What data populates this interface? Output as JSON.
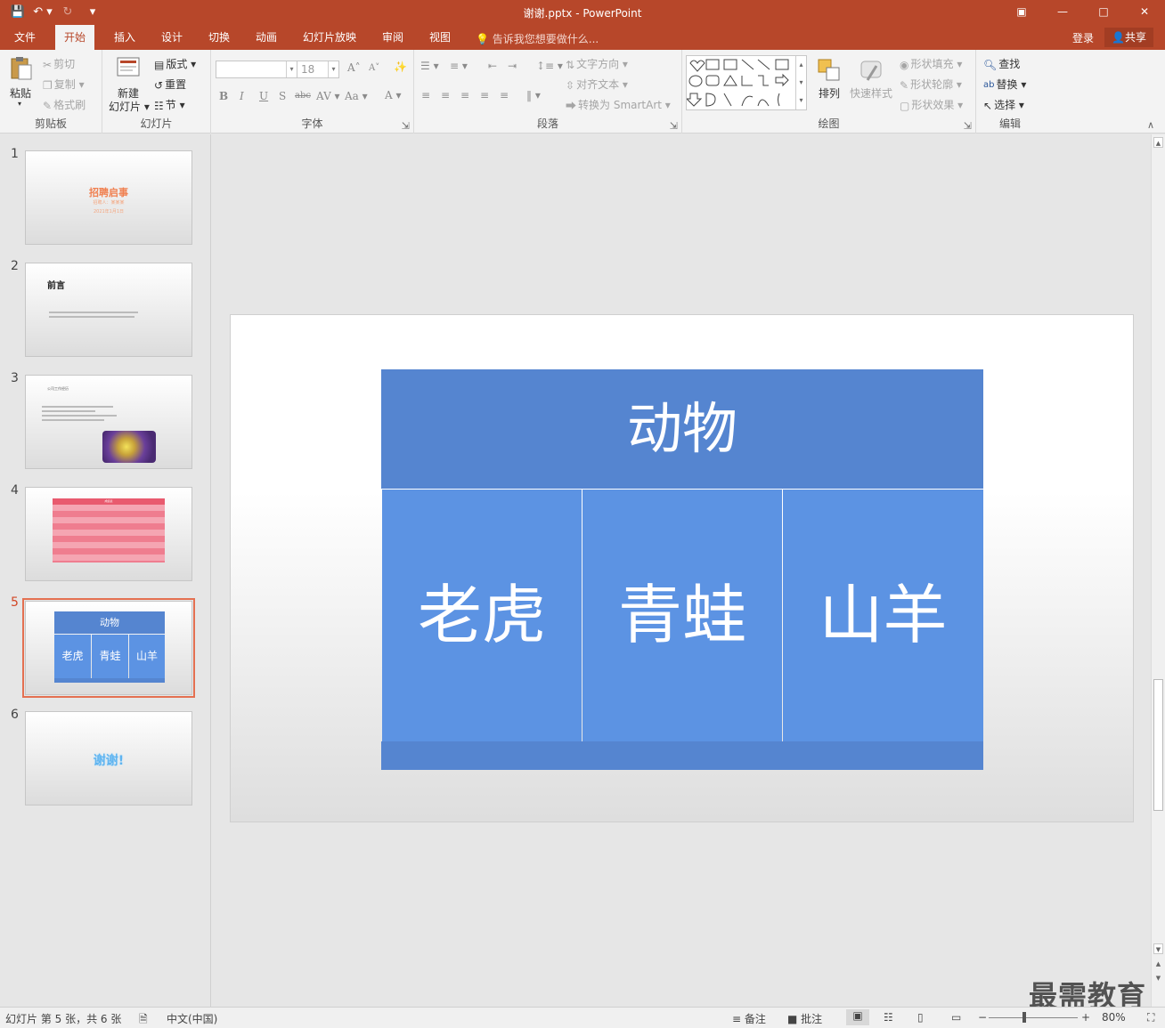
{
  "titlebar": {
    "title": "谢谢.pptx - PowerPoint",
    "qat": [
      "save-icon",
      "undo-icon",
      "redo-icon",
      "customize-icon"
    ],
    "window_buttons": [
      "ribbon-options-icon",
      "minimize-icon",
      "maximize-icon",
      "close-icon"
    ]
  },
  "tabs": {
    "items": [
      "文件",
      "开始",
      "插入",
      "设计",
      "切换",
      "动画",
      "幻灯片放映",
      "审阅",
      "视图"
    ],
    "active": "开始",
    "tell_me": "告诉我您想要做什么...",
    "login": "登录",
    "share": "共享"
  },
  "ribbon": {
    "clipboard": {
      "label": "剪贴板",
      "paste": "粘贴",
      "cut": "剪切",
      "copy": "复制",
      "format_painter": "格式刷"
    },
    "slides": {
      "label": "幻灯片",
      "new_slide": "新建",
      "new_slide_2": "幻灯片",
      "layout": "版式",
      "reset": "重置",
      "section": "节"
    },
    "font": {
      "label": "字体",
      "font_name": "",
      "font_size": "18",
      "bold": "B",
      "italic": "I",
      "underline": "U",
      "shadow": "S",
      "strike": "abc",
      "spacing": "AV",
      "case": "Aa",
      "color": "A"
    },
    "paragraph": {
      "label": "段落",
      "text_direction": "文字方向",
      "align_text": "对齐文本",
      "smartart": "转换为 SmartArt"
    },
    "drawing": {
      "label": "绘图",
      "arrange": "排列",
      "quick_styles": "快速样式",
      "shape_fill": "形状填充",
      "shape_outline": "形状轮廓",
      "shape_effects": "形状效果"
    },
    "editing": {
      "label": "编辑",
      "find": "查找",
      "replace": "替换",
      "select": "选择"
    }
  },
  "thumbnails": [
    {
      "num": "1",
      "title": "招聘启事",
      "sub1": "招聘人：某某某",
      "sub2": "2021年1月1日"
    },
    {
      "num": "2",
      "title": "前言"
    },
    {
      "num": "3",
      "title": "公司工作经历"
    },
    {
      "num": "4",
      "title": "成绩表"
    },
    {
      "num": "5",
      "header": "动物",
      "c1": "老虎",
      "c2": "青蛙",
      "c3": "山羊"
    },
    {
      "num": "6",
      "title": "谢谢!"
    }
  ],
  "selected_slide": "5",
  "slide": {
    "header": "动物",
    "cells": [
      "老虎",
      "青蛙",
      "山羊"
    ],
    "colors": {
      "header": "#5585d0",
      "cell": "#5c93e3",
      "footer": "#5585d0",
      "text": "#ffffff"
    }
  },
  "statusbar": {
    "slide_info": "幻灯片 第 5 张，共 6 张",
    "language": "中文(中国)",
    "notes": "备注",
    "comments": "批注",
    "zoom": "80%"
  },
  "watermark": "最需教育",
  "accent": "#b7472a"
}
